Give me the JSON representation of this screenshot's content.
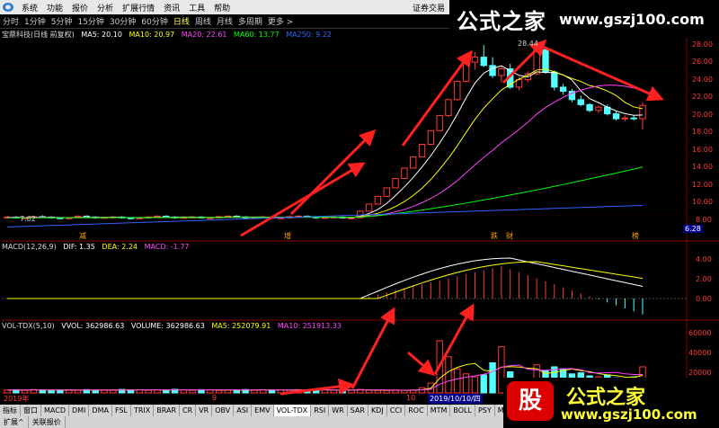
{
  "menu": {
    "items": [
      "系统",
      "功能",
      "报价",
      "分析",
      "扩展行情",
      "资讯",
      "工具",
      "帮助"
    ],
    "right_text": "证券交易"
  },
  "periods": {
    "items": [
      "分时",
      "1分钟",
      "5分钟",
      "15分钟",
      "30分钟",
      "60分钟",
      "日线",
      "周线",
      "月线",
      "多周期",
      "更多 >"
    ],
    "active_index": 6
  },
  "watermark_top": {
    "cn": "公式之家",
    "url": "www.gszj100.com"
  },
  "watermark_bottom": {
    "badge": "股",
    "cn": "公式之家",
    "url": "www.gszj100.com"
  },
  "price_legend": {
    "title": "宝鼎科技(日线 前复权)",
    "ma5": "MA5: 20.10",
    "ma10": "MA10: 20.97",
    "ma20": "MA20: 22.61",
    "ma60": "MA60: 13.77",
    "ma250": "MA250: 9.22"
  },
  "macd_legend": {
    "title": "MACD(12,26,9)",
    "dif": "DIF: 1.35",
    "dea": "DEA: 2.24",
    "macd": "MACD: -1.77"
  },
  "vol_legend": {
    "title": "VOL-TDX(5,10)",
    "vvol": "VVOL: 362986.63",
    "volume": "VOLUME: 362986.63",
    "ma5": "MA5: 252079.91",
    "ma10": "MA10: 251913.33"
  },
  "price_axis": [
    "28.00",
    "26.00",
    "24.00",
    "22.00",
    "20.00",
    "18.00",
    "16.00",
    "14.00",
    "12.00",
    "10.00",
    "8.00"
  ],
  "price_current": "6.28",
  "price_low_label": "7.62",
  "price_high_label": "28.44",
  "macd_axis": [
    "4.00",
    "2.00",
    "0.00"
  ],
  "vol_axis": [
    "60000",
    "40000",
    "20000"
  ],
  "event_marks": [
    "减",
    "增",
    "跌",
    "财",
    "榜"
  ],
  "time_axis": {
    "year": "2019年",
    "m9": "9",
    "m10": "10",
    "cursor_date": "2019/10/10/四"
  },
  "indicator_tabs": [
    "指标",
    "窗口",
    "MACD",
    "DMI",
    "DMA",
    "FSL",
    "TRIX",
    "BRAR",
    "CR",
    "VR",
    "OBV",
    "ASI",
    "EMV",
    "VOL-TDX",
    "RSI",
    "WR",
    "SAR",
    "KDJ",
    "CCI",
    "ROC",
    "MTM",
    "BOLL",
    "PSY",
    "MCST"
  ],
  "active_tab": "VOL-TDX",
  "bottom_tabs": [
    "扩展^",
    "关联报价"
  ],
  "colors": {
    "up": "#ff3a3a",
    "down": "#54ffff",
    "ma5": "#ffffff",
    "ma10": "#ffff00",
    "ma20": "#ff40ff",
    "ma60": "#00ff00",
    "ma250": "#3060ff",
    "arrow": "#ff2020"
  },
  "chart_data": {
    "type": "candlestick",
    "ohlc": [
      [
        7.7,
        7.9,
        7.6,
        7.8
      ],
      [
        7.8,
        7.9,
        7.6,
        7.7
      ],
      [
        7.7,
        7.8,
        7.6,
        7.7
      ],
      [
        7.7,
        7.9,
        7.6,
        7.85
      ],
      [
        7.85,
        8.0,
        7.7,
        7.8
      ],
      [
        7.8,
        7.9,
        7.6,
        7.7
      ],
      [
        7.7,
        7.8,
        7.5,
        7.6
      ],
      [
        7.6,
        7.8,
        7.5,
        7.7
      ],
      [
        7.7,
        8.0,
        7.6,
        7.9
      ],
      [
        7.9,
        8.0,
        7.7,
        7.8
      ],
      [
        7.8,
        7.9,
        7.6,
        7.7
      ],
      [
        7.7,
        7.8,
        7.6,
        7.75
      ],
      [
        7.75,
        7.9,
        7.6,
        7.8
      ],
      [
        7.8,
        7.9,
        7.6,
        7.7
      ],
      [
        7.7,
        7.8,
        7.5,
        7.6
      ],
      [
        7.6,
        7.8,
        7.5,
        7.7
      ],
      [
        7.7,
        7.9,
        7.6,
        7.8
      ],
      [
        7.8,
        8.0,
        7.7,
        7.9
      ],
      [
        7.9,
        8.0,
        7.7,
        7.8
      ],
      [
        7.8,
        7.9,
        7.6,
        7.7
      ],
      [
        7.7,
        7.8,
        7.6,
        7.75
      ],
      [
        7.75,
        7.9,
        7.7,
        7.8
      ],
      [
        7.8,
        7.9,
        7.6,
        7.7
      ],
      [
        7.7,
        7.8,
        7.6,
        7.7
      ],
      [
        7.7,
        7.9,
        7.6,
        7.85
      ],
      [
        7.85,
        8.0,
        7.7,
        7.9
      ],
      [
        7.9,
        8.0,
        7.7,
        7.8
      ],
      [
        7.8,
        7.9,
        7.6,
        7.7
      ],
      [
        7.7,
        7.8,
        7.6,
        7.75
      ],
      [
        7.75,
        7.9,
        7.7,
        7.8
      ],
      [
        7.8,
        7.9,
        7.6,
        7.7
      ],
      [
        7.7,
        7.8,
        7.6,
        7.7
      ],
      [
        7.7,
        7.9,
        7.6,
        7.85
      ],
      [
        7.85,
        8.0,
        7.7,
        7.9
      ],
      [
        7.9,
        8.0,
        7.7,
        7.8
      ],
      [
        7.8,
        7.9,
        7.6,
        7.7
      ],
      [
        7.7,
        7.8,
        7.6,
        7.75
      ],
      [
        7.75,
        7.9,
        7.7,
        7.8
      ],
      [
        7.8,
        7.9,
        7.6,
        7.7
      ],
      [
        7.7,
        7.8,
        7.6,
        7.7
      ],
      [
        7.7,
        8.6,
        7.7,
        8.5
      ],
      [
        8.5,
        9.4,
        8.5,
        9.35
      ],
      [
        9.35,
        10.3,
        9.35,
        10.28
      ],
      [
        10.28,
        11.3,
        10.28,
        11.3
      ],
      [
        11.3,
        12.45,
        11.3,
        12.43
      ],
      [
        12.43,
        13.7,
        12.43,
        13.67
      ],
      [
        13.67,
        15.0,
        13.67,
        15.03
      ],
      [
        15.03,
        16.6,
        15.03,
        16.53
      ],
      [
        16.53,
        18.2,
        16.53,
        18.18
      ],
      [
        18.18,
        20.0,
        18.18,
        20.0
      ],
      [
        20.0,
        22.0,
        19.8,
        21.9
      ],
      [
        21.9,
        24.2,
        21.8,
        24.1
      ],
      [
        24.1,
        26.5,
        24.0,
        26.4
      ],
      [
        26.4,
        27.6,
        25.5,
        27.0
      ],
      [
        27.0,
        28.44,
        25.8,
        26.0
      ],
      [
        26.0,
        27.0,
        24.5,
        24.8
      ],
      [
        24.8,
        25.9,
        24.0,
        25.6
      ],
      [
        25.6,
        26.2,
        23.2,
        23.4
      ],
      [
        23.4,
        24.6,
        23.0,
        24.3
      ],
      [
        24.3,
        25.3,
        24.0,
        25.0
      ],
      [
        25.0,
        28.2,
        24.8,
        27.9
      ],
      [
        27.9,
        28.0,
        25.0,
        25.2
      ],
      [
        25.2,
        25.4,
        23.0,
        23.4
      ],
      [
        23.4,
        23.8,
        22.5,
        22.9
      ],
      [
        22.9,
        23.2,
        21.6,
        21.9
      ],
      [
        21.9,
        22.4,
        21.1,
        21.3
      ],
      [
        21.3,
        21.5,
        20.4,
        20.6
      ],
      [
        20.6,
        21.2,
        20.3,
        21.0
      ],
      [
        21.0,
        21.3,
        20.0,
        20.2
      ],
      [
        20.2,
        20.5,
        19.4,
        19.6
      ],
      [
        19.6,
        20.0,
        19.3,
        19.7
      ],
      [
        19.7,
        20.0,
        19.4,
        19.6
      ],
      [
        19.6,
        21.6,
        18.3,
        21.2
      ]
    ],
    "macd": {
      "dif_end": 1.35,
      "dea_end": 2.24,
      "macd_end": -1.77,
      "hist_peak": 3.6,
      "dif_peak": 4.5
    },
    "volume": [
      2800,
      3200,
      2600,
      3400,
      3000,
      2500,
      2900,
      3100,
      2700,
      3300,
      2600,
      3000,
      2800,
      3500,
      2900,
      3200,
      2700,
      3100,
      2800,
      3600,
      3000,
      2700,
      3300,
      2900,
      2600,
      3100,
      2800,
      3400,
      2700,
      3200,
      2900,
      3000,
      2600,
      3300,
      3100,
      2800,
      3200,
      2700,
      3000,
      2900,
      3500,
      2800,
      2500,
      2400,
      2600,
      2700,
      3000,
      5200,
      9800,
      52000,
      36000,
      24000,
      19000,
      16000,
      18000,
      30000,
      46000,
      21000,
      14000,
      12000,
      28000,
      22000,
      26000,
      24000,
      19000,
      20000,
      17000,
      16000,
      18000,
      15000,
      13000,
      16000,
      26000
    ],
    "vol_max": 60000,
    "ylim": [
      6,
      28.9
    ]
  }
}
